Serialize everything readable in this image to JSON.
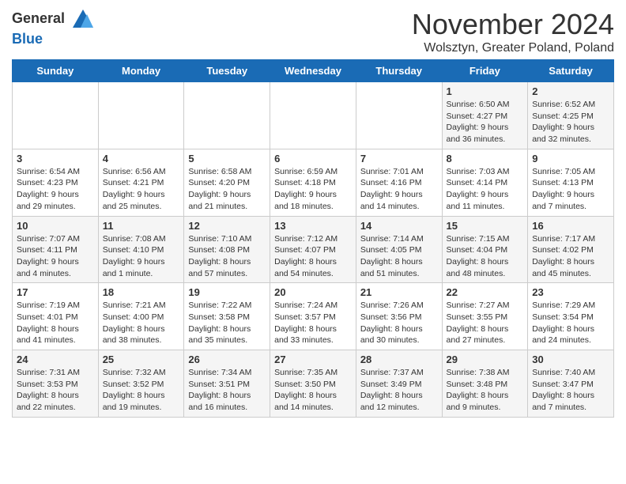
{
  "logo": {
    "general": "General",
    "blue": "Blue"
  },
  "header": {
    "month_year": "November 2024",
    "location": "Wolsztyn, Greater Poland, Poland"
  },
  "days_of_week": [
    "Sunday",
    "Monday",
    "Tuesday",
    "Wednesday",
    "Thursday",
    "Friday",
    "Saturday"
  ],
  "weeks": [
    [
      {
        "day": "",
        "info": ""
      },
      {
        "day": "",
        "info": ""
      },
      {
        "day": "",
        "info": ""
      },
      {
        "day": "",
        "info": ""
      },
      {
        "day": "",
        "info": ""
      },
      {
        "day": "1",
        "info": "Sunrise: 6:50 AM\nSunset: 4:27 PM\nDaylight: 9 hours and 36 minutes."
      },
      {
        "day": "2",
        "info": "Sunrise: 6:52 AM\nSunset: 4:25 PM\nDaylight: 9 hours and 32 minutes."
      }
    ],
    [
      {
        "day": "3",
        "info": "Sunrise: 6:54 AM\nSunset: 4:23 PM\nDaylight: 9 hours and 29 minutes."
      },
      {
        "day": "4",
        "info": "Sunrise: 6:56 AM\nSunset: 4:21 PM\nDaylight: 9 hours and 25 minutes."
      },
      {
        "day": "5",
        "info": "Sunrise: 6:58 AM\nSunset: 4:20 PM\nDaylight: 9 hours and 21 minutes."
      },
      {
        "day": "6",
        "info": "Sunrise: 6:59 AM\nSunset: 4:18 PM\nDaylight: 9 hours and 18 minutes."
      },
      {
        "day": "7",
        "info": "Sunrise: 7:01 AM\nSunset: 4:16 PM\nDaylight: 9 hours and 14 minutes."
      },
      {
        "day": "8",
        "info": "Sunrise: 7:03 AM\nSunset: 4:14 PM\nDaylight: 9 hours and 11 minutes."
      },
      {
        "day": "9",
        "info": "Sunrise: 7:05 AM\nSunset: 4:13 PM\nDaylight: 9 hours and 7 minutes."
      }
    ],
    [
      {
        "day": "10",
        "info": "Sunrise: 7:07 AM\nSunset: 4:11 PM\nDaylight: 9 hours and 4 minutes."
      },
      {
        "day": "11",
        "info": "Sunrise: 7:08 AM\nSunset: 4:10 PM\nDaylight: 9 hours and 1 minute."
      },
      {
        "day": "12",
        "info": "Sunrise: 7:10 AM\nSunset: 4:08 PM\nDaylight: 8 hours and 57 minutes."
      },
      {
        "day": "13",
        "info": "Sunrise: 7:12 AM\nSunset: 4:07 PM\nDaylight: 8 hours and 54 minutes."
      },
      {
        "day": "14",
        "info": "Sunrise: 7:14 AM\nSunset: 4:05 PM\nDaylight: 8 hours and 51 minutes."
      },
      {
        "day": "15",
        "info": "Sunrise: 7:15 AM\nSunset: 4:04 PM\nDaylight: 8 hours and 48 minutes."
      },
      {
        "day": "16",
        "info": "Sunrise: 7:17 AM\nSunset: 4:02 PM\nDaylight: 8 hours and 45 minutes."
      }
    ],
    [
      {
        "day": "17",
        "info": "Sunrise: 7:19 AM\nSunset: 4:01 PM\nDaylight: 8 hours and 41 minutes."
      },
      {
        "day": "18",
        "info": "Sunrise: 7:21 AM\nSunset: 4:00 PM\nDaylight: 8 hours and 38 minutes."
      },
      {
        "day": "19",
        "info": "Sunrise: 7:22 AM\nSunset: 3:58 PM\nDaylight: 8 hours and 35 minutes."
      },
      {
        "day": "20",
        "info": "Sunrise: 7:24 AM\nSunset: 3:57 PM\nDaylight: 8 hours and 33 minutes."
      },
      {
        "day": "21",
        "info": "Sunrise: 7:26 AM\nSunset: 3:56 PM\nDaylight: 8 hours and 30 minutes."
      },
      {
        "day": "22",
        "info": "Sunrise: 7:27 AM\nSunset: 3:55 PM\nDaylight: 8 hours and 27 minutes."
      },
      {
        "day": "23",
        "info": "Sunrise: 7:29 AM\nSunset: 3:54 PM\nDaylight: 8 hours and 24 minutes."
      }
    ],
    [
      {
        "day": "24",
        "info": "Sunrise: 7:31 AM\nSunset: 3:53 PM\nDaylight: 8 hours and 22 minutes."
      },
      {
        "day": "25",
        "info": "Sunrise: 7:32 AM\nSunset: 3:52 PM\nDaylight: 8 hours and 19 minutes."
      },
      {
        "day": "26",
        "info": "Sunrise: 7:34 AM\nSunset: 3:51 PM\nDaylight: 8 hours and 16 minutes."
      },
      {
        "day": "27",
        "info": "Sunrise: 7:35 AM\nSunset: 3:50 PM\nDaylight: 8 hours and 14 minutes."
      },
      {
        "day": "28",
        "info": "Sunrise: 7:37 AM\nSunset: 3:49 PM\nDaylight: 8 hours and 12 minutes."
      },
      {
        "day": "29",
        "info": "Sunrise: 7:38 AM\nSunset: 3:48 PM\nDaylight: 8 hours and 9 minutes."
      },
      {
        "day": "30",
        "info": "Sunrise: 7:40 AM\nSunset: 3:47 PM\nDaylight: 8 hours and 7 minutes."
      }
    ]
  ]
}
